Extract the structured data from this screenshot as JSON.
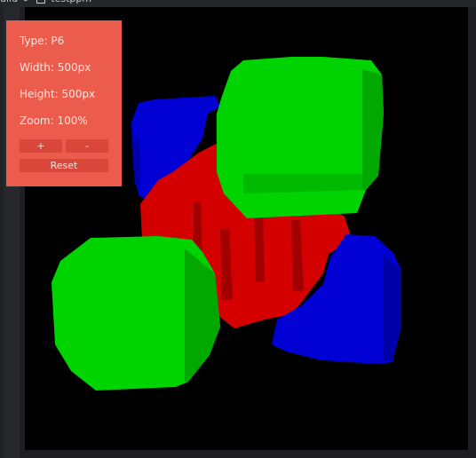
{
  "breadcrumb": {
    "parent": "uild",
    "separator": ">",
    "file": "testppm"
  },
  "info_panel": {
    "type": "Type: P6",
    "width": "Width: 500px",
    "height": "Height: 500px",
    "zoom": "Zoom: 100%",
    "zoom_in": "+",
    "zoom_out": "-",
    "reset": "Reset"
  },
  "colors": {
    "panel_bg": "#ec5c4c",
    "button_bg": "#d9473a",
    "red": "#d40000",
    "green": "#00d400",
    "blue": "#0000d4"
  },
  "icons": [
    "file-icon"
  ]
}
